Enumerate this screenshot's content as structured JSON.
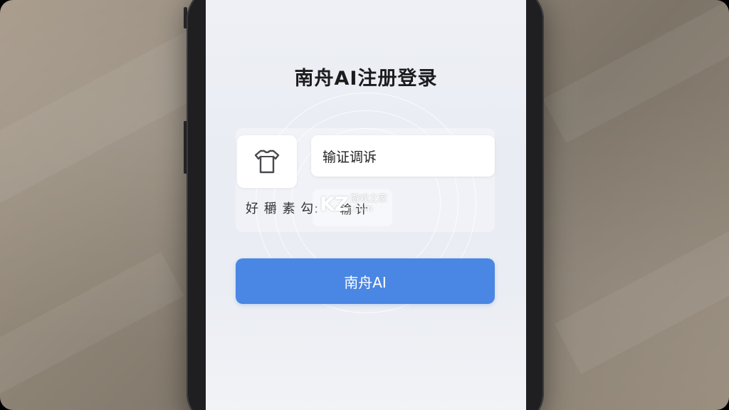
{
  "page": {
    "title": "南舟AI注册登录"
  },
  "form": {
    "code_input_value": "输证调诉",
    "garbled_label": "好 穱 素 勾:",
    "small_input_value": "输 计"
  },
  "buttons": {
    "primary_label": "南舟AI"
  },
  "watermark": {
    "logo": "KZ",
    "cn": "游戏之家",
    "domain": ".com"
  },
  "colors": {
    "primary": "#4a86e3",
    "screen_bg": "#eef0f5",
    "title": "#1c1c1e"
  },
  "icons": {
    "tile_icon": "shirt-icon"
  }
}
